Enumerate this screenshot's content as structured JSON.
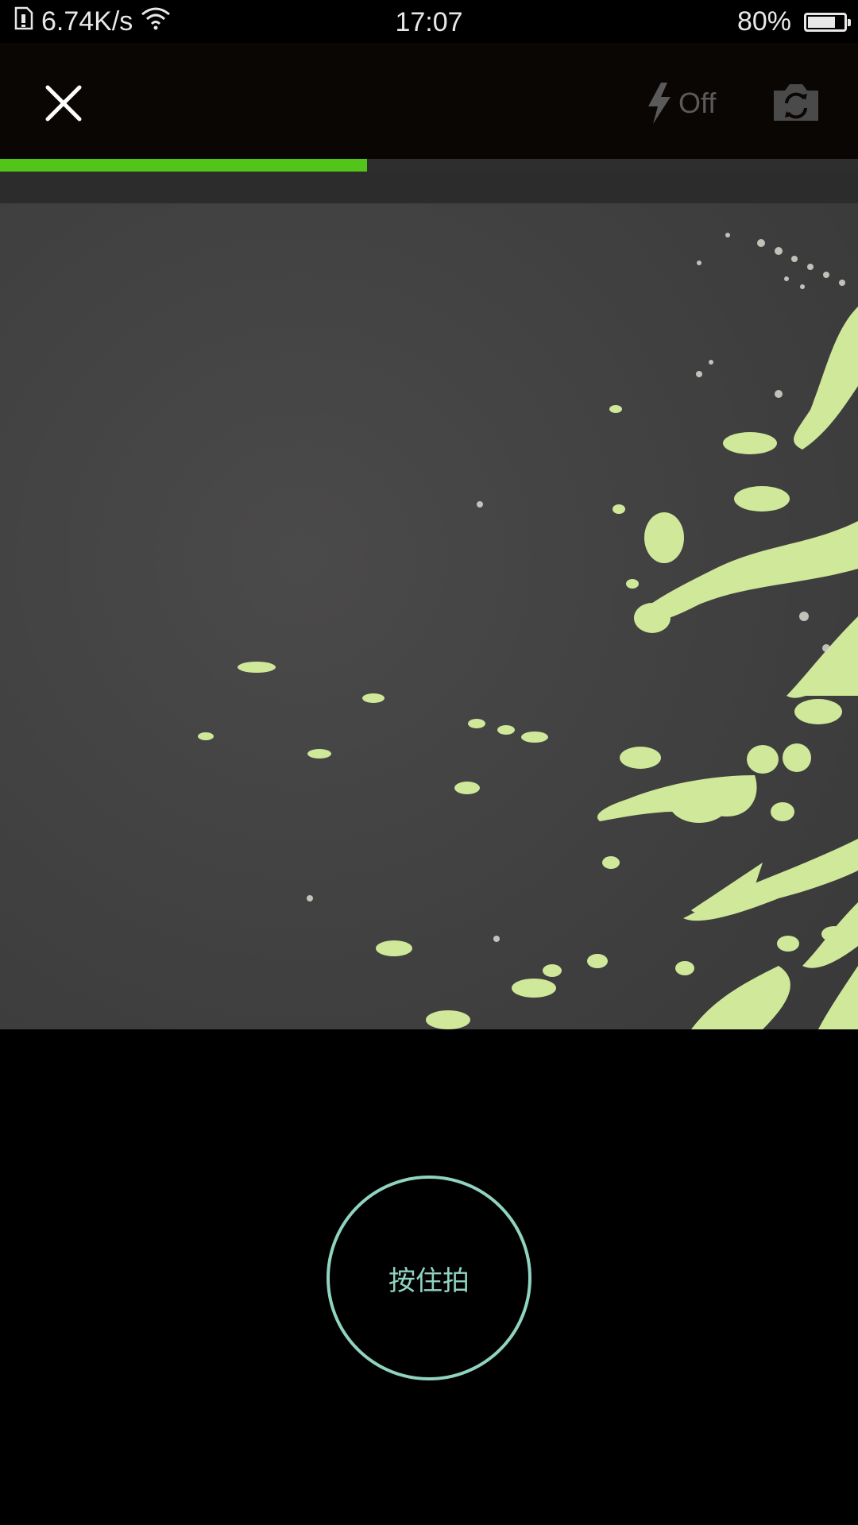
{
  "status_bar": {
    "network_speed": "6.74K/s",
    "time": "17:07",
    "battery_percent": "80%",
    "battery_level": 0.8
  },
  "toolbar": {
    "close_icon": "close-icon",
    "flash_icon": "flash-icon",
    "flash_state": "Off",
    "flip_icon": "camera-flip-icon"
  },
  "recording": {
    "progress": 0.428,
    "progress_color": "#52c41a"
  },
  "shutter": {
    "label": "按住拍",
    "ring_color": "#8fd3c0"
  }
}
